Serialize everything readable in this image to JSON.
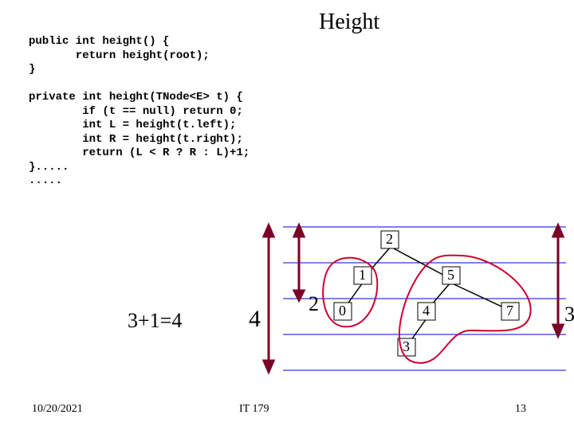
{
  "title": "Height",
  "code_block1": "public int height() {\n       return height(root);\n}",
  "code_block2": "private int height(TNode<E> t) {\n        if (t == null) return 0;\n        int L = height(t.left);\n        int R = height(t.right);\n        return (L < R ? R : L)+1;\n}.....\n.....",
  "equation": "3+1=4",
  "big_label_4": "4",
  "tree": {
    "root": "2",
    "level2": {
      "left": "1",
      "right": "5"
    },
    "level3": {
      "n0": "0",
      "n4": "4",
      "n7": "7"
    },
    "level4": {
      "n3": "3"
    },
    "side_labels": {
      "left": "2",
      "right": "3"
    }
  },
  "footer": {
    "date": "10/20/2021",
    "course": "IT 179",
    "page": "13"
  }
}
